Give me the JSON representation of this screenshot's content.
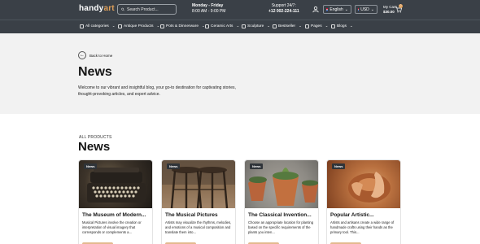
{
  "header": {
    "logo_main": "handy",
    "logo_accent": "art",
    "search_placeholder": "Search Product...",
    "hours_days": "Monday - Friday",
    "hours_time": "8:00 AM - 9:00 PM",
    "support_label": "Support 24/7:",
    "support_phone": "+12 002-224-111",
    "language": "English",
    "currency": "USD",
    "cart_label": "My Cart:",
    "cart_total": "$30.00",
    "cart_count": "0"
  },
  "nav": {
    "items": [
      {
        "label": "All categories"
      },
      {
        "label": "Antique Products"
      },
      {
        "label": "Pots & Dinnerware"
      },
      {
        "label": "Ceramic Arts"
      },
      {
        "label": "Sculpture"
      },
      {
        "label": "Bestseller"
      },
      {
        "label": "Pages"
      },
      {
        "label": "Blogs"
      }
    ]
  },
  "hero": {
    "back_label": "Back to Home",
    "title": "News",
    "description": "Welcome to our vibrant and insightful blog, your go-to destination for captivating stories, thought-provoking articles, and expert advice."
  },
  "section": {
    "kicker": "ALL PRODUCTS",
    "title": "News"
  },
  "cards": [
    {
      "tag": "News",
      "title": "The Museum of Modern...",
      "desc": "Musical Pictures involve the creation or interpretation of visual imagery that corresponds or complements a...",
      "date": "",
      "image": "typewriter"
    },
    {
      "tag": "News",
      "title": "The Musical Pictures",
      "desc": "Artists may visualize the rhythms, melodies, and emotions of a musical composition and translate them into...",
      "date": "",
      "image": "stools"
    },
    {
      "tag": "News",
      "title": "The Classical Invention...",
      "desc": "Choose an appropriate location for planting based on the specific requirements of the plants you inten...",
      "date": "",
      "image": "pots"
    },
    {
      "tag": "News",
      "title": "Popular Artistic...",
      "desc": "Artists and artisans create a wide range of handmade crafts using their hands as the primary tool. This...",
      "date": "",
      "image": "hands"
    }
  ],
  "colors": {
    "header_bg": "#3a4047",
    "accent": "#e0a05a",
    "hero_bg": "#f2f2f2",
    "button": "#e4b98f"
  }
}
